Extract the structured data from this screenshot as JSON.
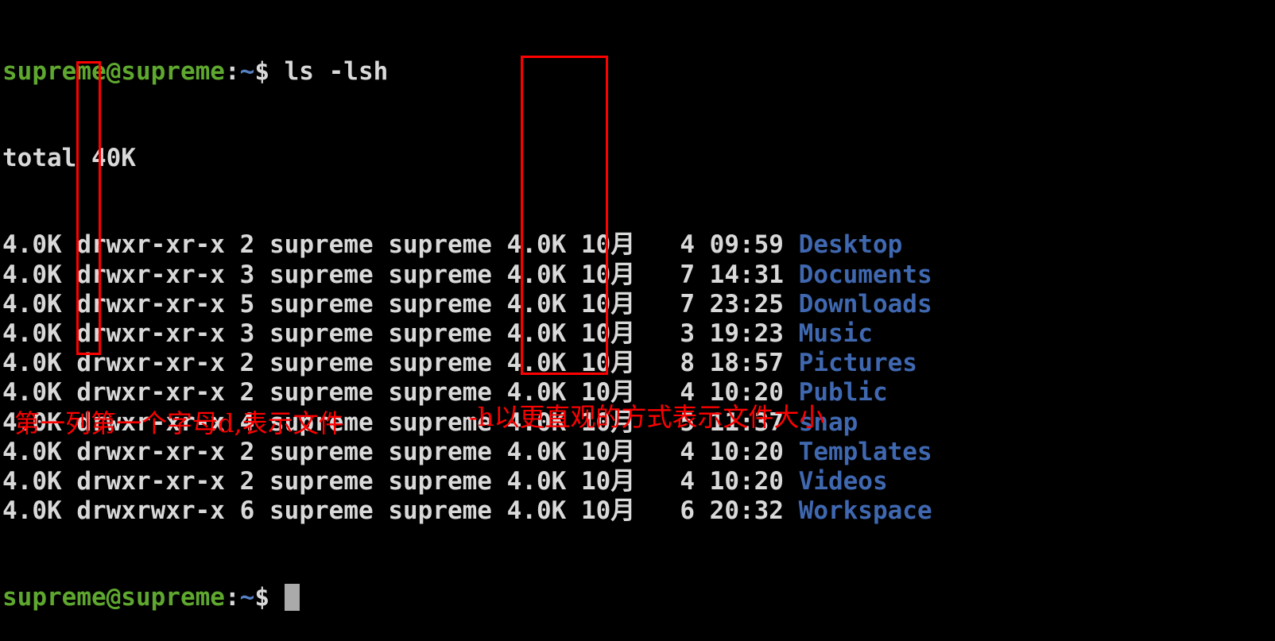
{
  "terminal": {
    "command_prompt": {
      "user_host": "supreme@supreme",
      "separator": ":",
      "path": "~",
      "symbol": "$",
      "command": " ls -lsh"
    },
    "total_line": "total 40K",
    "rows": [
      {
        "size": "4.0K",
        "type": "d",
        "perm": "rwxr-xr-x",
        "links": "2",
        "owner": "supreme",
        "group": "supreme",
        "fsize": "4.0K",
        "month": "10月",
        "day": "4",
        "time": "09:59",
        "name": "Desktop"
      },
      {
        "size": "4.0K",
        "type": "d",
        "perm": "rwxr-xr-x",
        "links": "3",
        "owner": "supreme",
        "group": "supreme",
        "fsize": "4.0K",
        "month": "10月",
        "day": "7",
        "time": "14:31",
        "name": "Documents"
      },
      {
        "size": "4.0K",
        "type": "d",
        "perm": "rwxr-xr-x",
        "links": "5",
        "owner": "supreme",
        "group": "supreme",
        "fsize": "4.0K",
        "month": "10月",
        "day": "7",
        "time": "23:25",
        "name": "Downloads"
      },
      {
        "size": "4.0K",
        "type": "d",
        "perm": "rwxr-xr-x",
        "links": "3",
        "owner": "supreme",
        "group": "supreme",
        "fsize": "4.0K",
        "month": "10月",
        "day": "3",
        "time": "19:23",
        "name": "Music"
      },
      {
        "size": "4.0K",
        "type": "d",
        "perm": "rwxr-xr-x",
        "links": "2",
        "owner": "supreme",
        "group": "supreme",
        "fsize": "4.0K",
        "month": "10月",
        "day": "8",
        "time": "18:57",
        "name": "Pictures"
      },
      {
        "size": "4.0K",
        "type": "d",
        "perm": "rwxr-xr-x",
        "links": "2",
        "owner": "supreme",
        "group": "supreme",
        "fsize": "4.0K",
        "month": "10月",
        "day": "4",
        "time": "10:20",
        "name": "Public"
      },
      {
        "size": "4.0K",
        "type": "d",
        "perm": "rwxr-xr-x",
        "links": "4",
        "owner": "supreme",
        "group": "supreme",
        "fsize": "4.0K",
        "month": "10月",
        "day": "5",
        "time": "11:37",
        "name": "snap"
      },
      {
        "size": "4.0K",
        "type": "d",
        "perm": "rwxr-xr-x",
        "links": "2",
        "owner": "supreme",
        "group": "supreme",
        "fsize": "4.0K",
        "month": "10月",
        "day": "4",
        "time": "10:20",
        "name": "Templates"
      },
      {
        "size": "4.0K",
        "type": "d",
        "perm": "rwxr-xr-x",
        "links": "2",
        "owner": "supreme",
        "group": "supreme",
        "fsize": "4.0K",
        "month": "10月",
        "day": "4",
        "time": "10:20",
        "name": "Videos"
      },
      {
        "size": "4.0K",
        "type": "d",
        "perm": "rwxrwxr-x",
        "links": "6",
        "owner": "supreme",
        "group": "supreme",
        "fsize": "4.0K",
        "month": "10月",
        "day": "6",
        "time": "20:32",
        "name": "Workspace"
      }
    ],
    "final_prompt": {
      "user_host": "supreme@supreme",
      "separator": ":",
      "path": "~",
      "symbol": "$"
    }
  },
  "annotations": {
    "first_column": "第一列第一个字母d,表示文件",
    "h_flag": "-h以更直观的方式表示文件大小"
  },
  "colors": {
    "background": "#000000",
    "text": "#d9d9d9",
    "prompt_user": "#5fa82f",
    "prompt_path": "#5580c2",
    "directory": "#3f68b0",
    "annotation": "#ff0000",
    "cursor": "#aaaaaa"
  }
}
